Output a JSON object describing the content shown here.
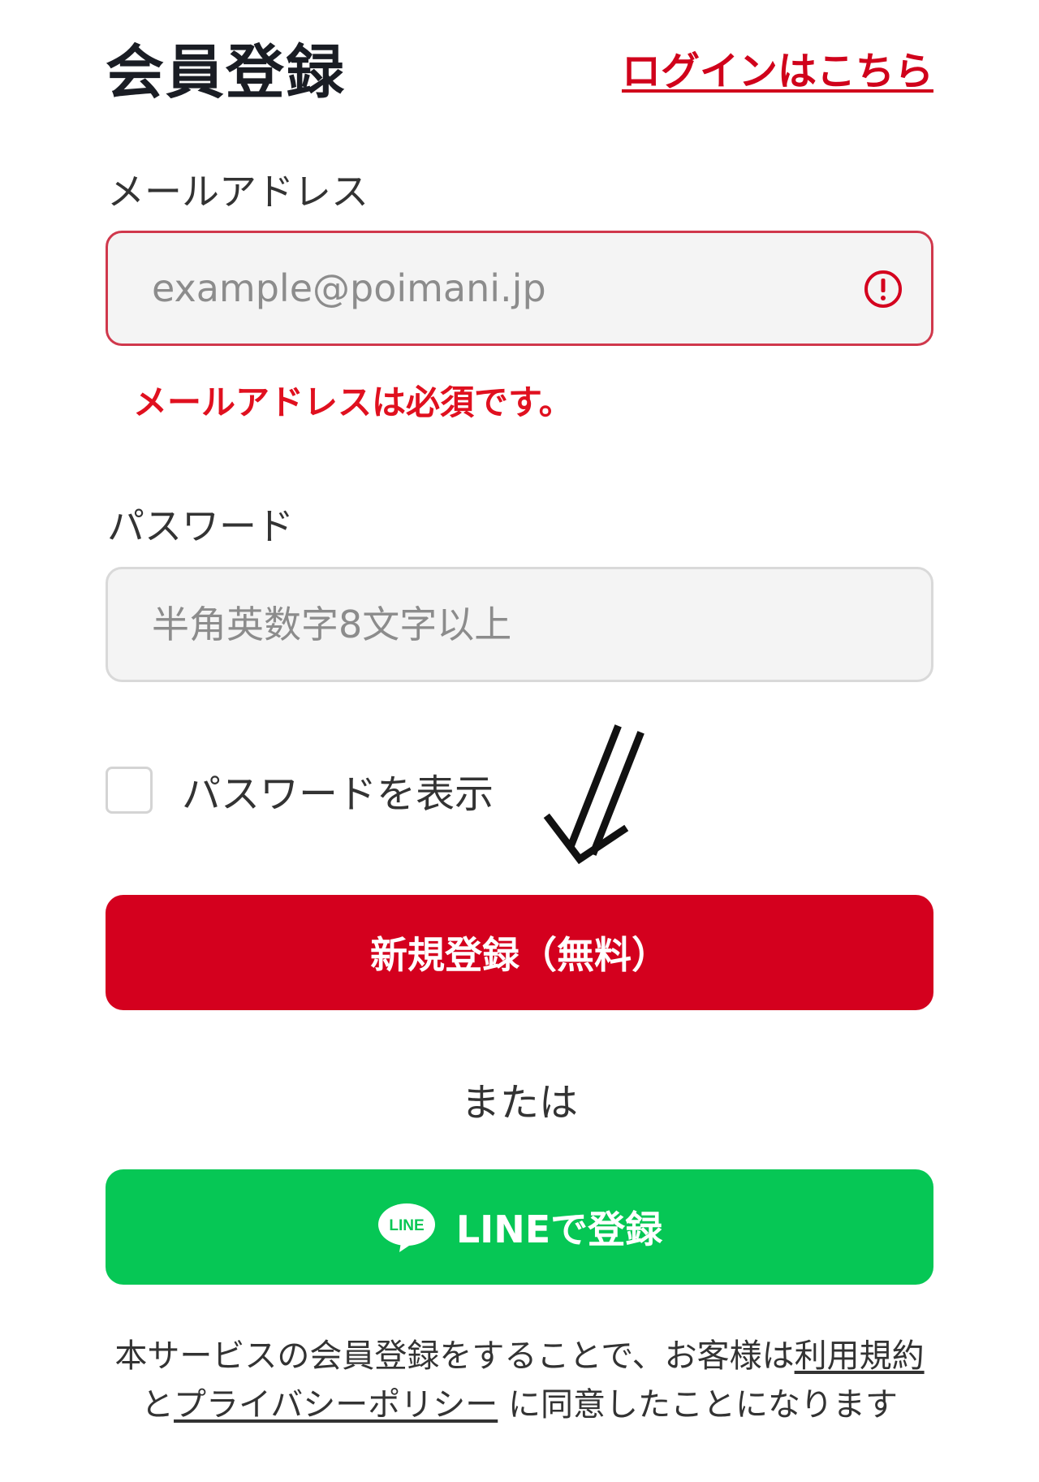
{
  "header": {
    "title": "会員登録",
    "login_link": "ログインはこちら"
  },
  "email": {
    "label": "メールアドレス",
    "value": "",
    "placeholder": "example@poimani.jp",
    "error": "メールアドレスは必須です。"
  },
  "password": {
    "label": "パスワード",
    "value": "",
    "placeholder": "半角英数字8文字以上",
    "show_label": "パスワードを表示"
  },
  "register_button": "新規登録（無料）",
  "or_text": "または",
  "line_button": {
    "label": "LINEで登録",
    "icon_text": "LINE"
  },
  "terms": {
    "prefix": "本サービスの会員登録をすることで、お客様は",
    "terms_link": "利用規約",
    "conjunction": "と",
    "privacy_link": "プライバシーポリシー",
    "suffix": " に同意したことになります"
  },
  "colors": {
    "brand_red": "#d4001e",
    "error_red": "#e0101f",
    "line_green": "#06c755"
  },
  "icons": [
    "error-icon",
    "down-arrow-icon",
    "line-logo-icon"
  ]
}
